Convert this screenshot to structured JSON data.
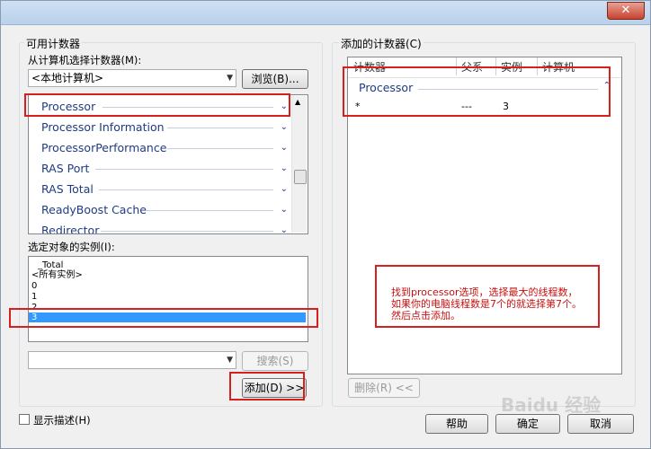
{
  "window": {
    "close_glyph": "✕"
  },
  "left": {
    "group_title": "可用计数器",
    "select_from_label": "从计算机选择计数器(M):",
    "computer_value": "<本地计算机>",
    "browse_label": "浏览(B)...",
    "objects": [
      "Processor",
      "Processor Information",
      "ProcessorPerformance",
      "RAS Port",
      "RAS Total",
      "ReadyBoost Cache",
      "Redirector"
    ],
    "instances_label": "选定对象的实例(I):",
    "instances": [
      "_Total",
      "<所有实例>",
      "0",
      "1",
      "2",
      "3"
    ],
    "search_label": "搜索(S)",
    "add_label": "添加(D) >>"
  },
  "right": {
    "group_title": "添加的计数器(C)",
    "headers": [
      "计数器",
      "父系",
      "实例",
      "计算机"
    ],
    "group_row": "Processor",
    "row": {
      "counter": "*",
      "parent": "---",
      "instance": "3"
    },
    "remove_label": "删除(R) <<",
    "note_lines": [
      "找到processor选项，选择最大的线程数，",
      "如果你的电脑线程数是7个的就选择第7个。",
      "然后点击添加。"
    ]
  },
  "footer": {
    "show_desc_label": "显示描述(H)",
    "help_label": "帮助",
    "ok_label": "确定",
    "cancel_label": "取消",
    "watermark": "Baidu 经验"
  }
}
